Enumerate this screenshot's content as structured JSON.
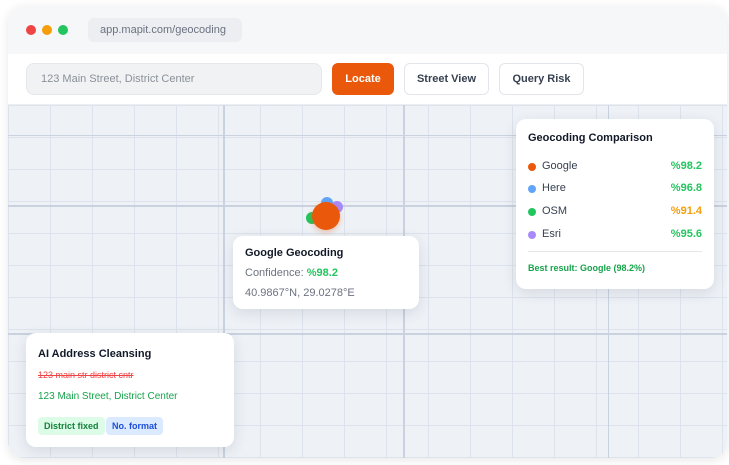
{
  "browser": {
    "url": "app.mapit.com/geocoding"
  },
  "toolbar": {
    "search_value": "123 Main Street, District Center",
    "locate_label": "Locate",
    "street_view_label": "Street View",
    "query_risk_label": "Query Risk"
  },
  "geocode_popup": {
    "title": "Google Geocoding",
    "confidence_label": "Confidence:",
    "confidence_value": "%98.2",
    "coordinates": "40.9867°N, 29.0278°E"
  },
  "comparison": {
    "title": "Geocoding Comparison",
    "providers": [
      {
        "name": "Google",
        "score": "%98.2",
        "color": "#ea580c",
        "score_color": "#22c55e"
      },
      {
        "name": "Here",
        "score": "%96.8",
        "color": "#60a5fa",
        "score_color": "#22c55e"
      },
      {
        "name": "OSM",
        "score": "%91.4",
        "color": "#22c55e",
        "score_color": "#f59e0b"
      },
      {
        "name": "Esri",
        "score": "%95.6",
        "color": "#a78bfa",
        "score_color": "#22c55e"
      }
    ],
    "best_result": "Best result: Google (98.2%)"
  },
  "cleansing": {
    "title": "AI Address Cleansing",
    "original": "123 main str district cntr",
    "cleaned": "123 Main Street, District Center",
    "tags": [
      "District fixed",
      "No. format"
    ]
  },
  "colors": {
    "accent": "#ea580c",
    "success": "#22c55e",
    "warning": "#f59e0b",
    "error": "#ef4444"
  }
}
